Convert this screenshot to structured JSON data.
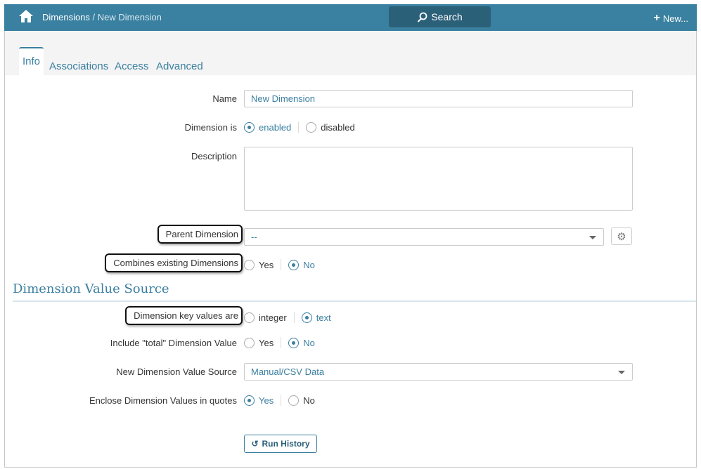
{
  "header": {
    "breadcrumb_root": "Dimensions",
    "breadcrumb_sep": " / ",
    "breadcrumb_current": "New Dimension",
    "search_label": "Search",
    "new_label": "New..."
  },
  "tabs": [
    "Info",
    "Associations",
    "Access",
    "Advanced"
  ],
  "form": {
    "name": {
      "label": "Name",
      "value": "New Dimension"
    },
    "enabled": {
      "label": "Dimension is",
      "options": [
        "enabled",
        "disabled"
      ],
      "selected": "enabled"
    },
    "description": {
      "label": "Description",
      "value": ""
    },
    "parent": {
      "label": "Parent Dimension",
      "value": "--"
    },
    "combines": {
      "label": "Combines existing Dimensions",
      "options": [
        "Yes",
        "No"
      ],
      "selected": "No"
    },
    "section_title": "Dimension Value Source",
    "key_values": {
      "label": "Dimension key values are",
      "options": [
        "integer",
        "text"
      ],
      "selected": "text"
    },
    "total": {
      "label": "Include \"total\" Dimension Value",
      "options": [
        "Yes",
        "No"
      ],
      "selected": "No"
    },
    "source": {
      "label": "New Dimension Value Source",
      "value": "Manual/CSV Data"
    },
    "quotes": {
      "label": "Enclose Dimension Values in quotes",
      "options": [
        "Yes",
        "No"
      ],
      "selected": "Yes"
    },
    "run_history": "Run History"
  }
}
